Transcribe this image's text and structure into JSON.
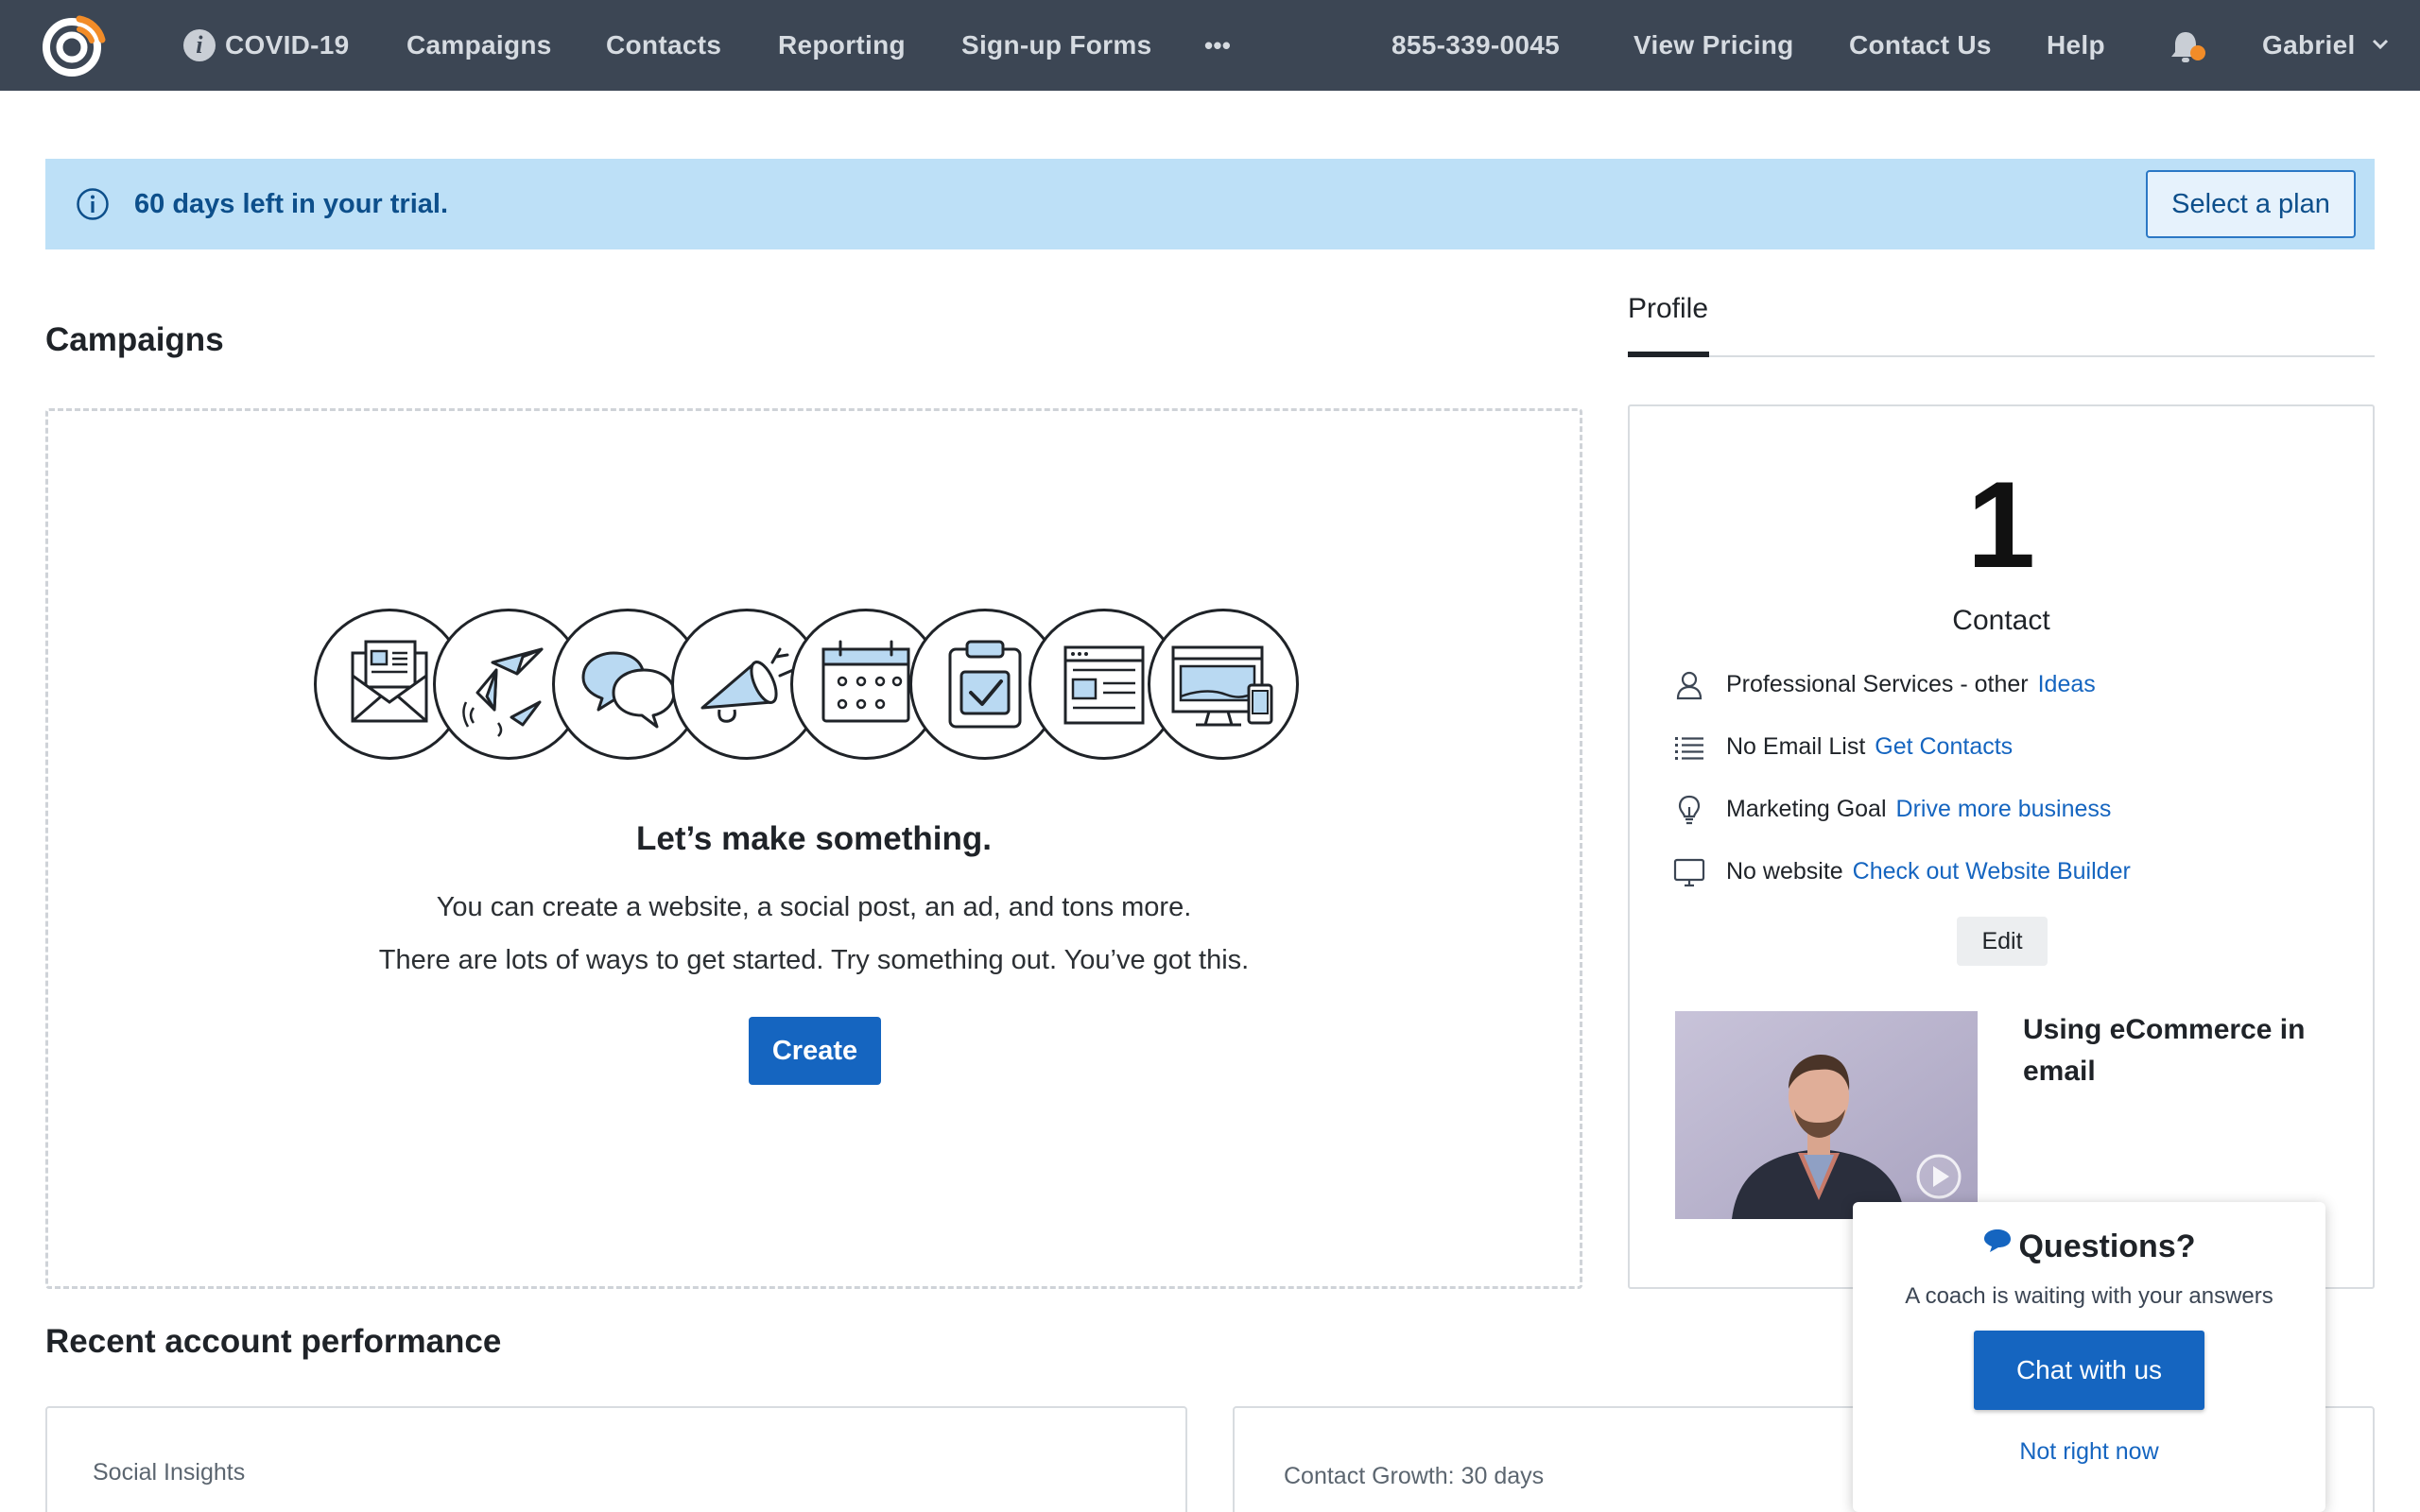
{
  "nav": {
    "covid": "COVID-19",
    "campaigns": "Campaigns",
    "contacts": "Contacts",
    "reporting": "Reporting",
    "signup_forms": "Sign-up Forms",
    "more": "•••",
    "phone": "855-339-0045",
    "view_pricing": "View Pricing",
    "contact_us": "Contact Us",
    "help": "Help",
    "user": "Gabriel",
    "icons": [
      "logo-icon",
      "info-icon",
      "bell-icon",
      "chevron-down-icon"
    ],
    "colors": {
      "background": "#3c4654",
      "notification_dot": "#f28c28"
    }
  },
  "banner": {
    "text": "60 days left in your trial.",
    "button": "Select a plan"
  },
  "campaigns": {
    "heading": "Campaigns",
    "icons": [
      "email-icon",
      "paper-planes-icon",
      "chat-bubbles-icon",
      "megaphone-icon",
      "calendar-icon",
      "clipboard-check-icon",
      "webpage-icon",
      "devices-icon"
    ],
    "title": "Let’s make something.",
    "line1": "You can create a website, a social post, an ad, and tons more.",
    "line2": "There are lots of ways to get started. Try something out. You’ve got this.",
    "create_button": "Create"
  },
  "recent": {
    "heading": "Recent account performance",
    "cards": [
      "Social Insights",
      "Contact Growth: 30 days"
    ]
  },
  "profile": {
    "tab": "Profile",
    "count": "1",
    "count_label": "Contact",
    "rows": [
      {
        "icon": "person-icon",
        "text": "Professional Services - other",
        "link": "Ideas"
      },
      {
        "icon": "list-icon",
        "text": "No Email List",
        "link": "Get Contacts"
      },
      {
        "icon": "lightbulb-icon",
        "text": "Marketing Goal",
        "link": "Drive more business"
      },
      {
        "icon": "monitor-icon",
        "text": "No website",
        "link": "Check out Website Builder"
      }
    ],
    "edit_button": "Edit",
    "video_title": "Using eCommerce in email"
  },
  "chat": {
    "title": "Questions?",
    "subtitle": "A coach is waiting with your answers",
    "button": "Chat with us",
    "dismiss": "Not right now"
  },
  "colors": {
    "link": "#1565c0",
    "primary_button": "#1565c0",
    "banner": "#bde0f7"
  }
}
